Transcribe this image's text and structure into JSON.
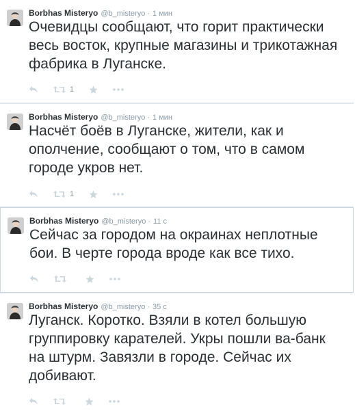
{
  "tweets": [
    {
      "name": "Borbhas Misteryo",
      "handle": "@b_misteryo",
      "time": "1 мин",
      "text": "Очевидцы сообщают, что горит практически весь восток, крупные магазины и трикотажная фабрика в Луганске.",
      "retweets": "1"
    },
    {
      "name": "Borbhas Misteryo",
      "handle": "@b_misteryo",
      "time": "1 мин",
      "text": "Насчёт боёв в Луганске, жители, как и ополчение, сообщают о том, что в самом городе укров нет.",
      "retweets": "1"
    },
    {
      "name": "Borbhas Misteryo",
      "handle": "@b_misteryo",
      "time": "11 с",
      "text": "Сейчас за городом на окраинах неплотные бои. В черте города вроде как все тихо.",
      "retweets": ""
    },
    {
      "name": "Borbhas Misteryo",
      "handle": "@b_misteryo",
      "time": "35 с",
      "text": "Луганск. Коротко. Взяли в котел большую группировку карателей. Укры пошли ва-банк на штурм. Завязли в городе. Сейчас их добивают.",
      "retweets": ""
    }
  ],
  "icons": {
    "reply": "reply-icon",
    "retweet": "retweet-icon",
    "favorite": "star-icon",
    "more": "more-icon",
    "avatar": "avatar-icon"
  },
  "colors": {
    "text": "#292f33",
    "meta": "#8899a6",
    "icon": "#ccd6dd",
    "border": "#e1e8ed"
  }
}
